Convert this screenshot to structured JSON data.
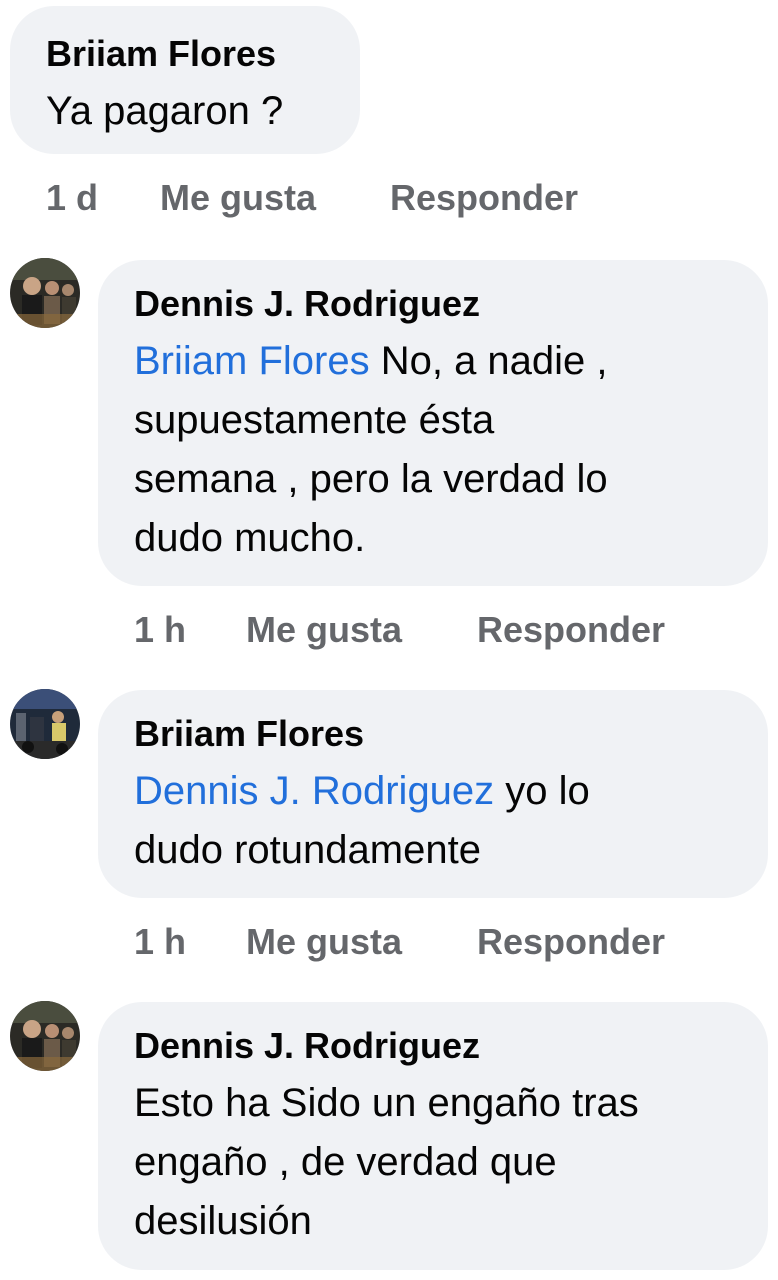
{
  "comments": [
    {
      "author": "Briiam Flores",
      "mention": "",
      "text": "Ya pagaron ?",
      "time": "1 d",
      "like_label": "Me gusta",
      "reply_label": "Responder"
    },
    {
      "author": "Dennis J. Rodriguez",
      "mention": "Briiam Flores",
      "text_line1": " No, a nadie ,",
      "text_line2": "supuestamente ésta",
      "text_line3": "semana , pero la verdad lo",
      "text_line4": "dudo mucho.",
      "time": "1 h",
      "like_label": "Me gusta",
      "reply_label": "Responder"
    },
    {
      "author": "Briiam Flores",
      "mention": "Dennis J. Rodriguez",
      "text_line1": " yo lo",
      "text_line2": "dudo rotundamente",
      "time": "1 h",
      "like_label": "Me gusta",
      "reply_label": "Responder"
    },
    {
      "author": "Dennis J. Rodriguez",
      "mention": "",
      "text_line1": "Esto ha Sido un engaño tras",
      "text_line2": "engaño , de verdad que",
      "text_line3": "desilusión"
    }
  ],
  "colors": {
    "bubble": "#f0f2f5",
    "mention": "#216fdb",
    "meta": "#65676b"
  }
}
